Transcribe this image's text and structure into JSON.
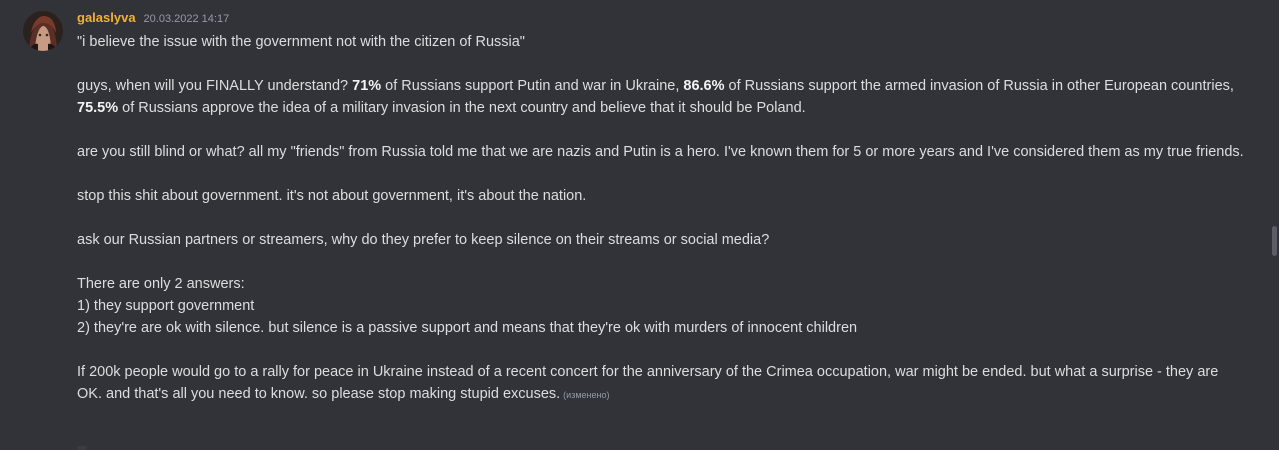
{
  "message": {
    "username": "galaslyva",
    "timestamp": "20.03.2022 14:17",
    "edited_label": "(изменено)",
    "colors": {
      "username": "#f0b232",
      "background": "#313338",
      "text": "#dbdee1"
    },
    "lines": {
      "quote": "\"i believe the issue with the government not with the citizen of Russia\"",
      "p2_a": "guys, when will you FINALLY understand? ",
      "p2_b": "71%",
      "p2_c": " of Russians support Putin and war in Ukraine, ",
      "p2_d": "86.6%",
      "p2_e": " of Russians support the armed invasion of Russia in other European countries, ",
      "p2_f": "75.5%",
      "p2_g": " of Russians approve the idea of a military invasion in the next country and believe that it should be Poland.",
      "p3": "are you still blind or what? all my \"friends\" from Russia told me that we are nazis and Putin is a hero. I've known them for 5 or more years and I've considered them as my true friends.",
      "p4": "stop this shit about government. it's not about government, it's about the nation.",
      "p5": "ask our Russian partners or streamers, why do they prefer to keep silence on their streams or social media?",
      "p6_l1": "There are only 2 answers:",
      "p6_l2": "1) they support government",
      "p6_l3": "2) they're are ok with silence. but silence is a passive support and means that they're ok with murders of innocent children",
      "p7": "If 200k people would go to a rally for peace in Ukraine instead of a recent concert for the anniversary of the Crimea occupation, war might be ended. but what a surprise - they are OK. and that's all you need to know. so please stop making stupid excuses."
    }
  }
}
